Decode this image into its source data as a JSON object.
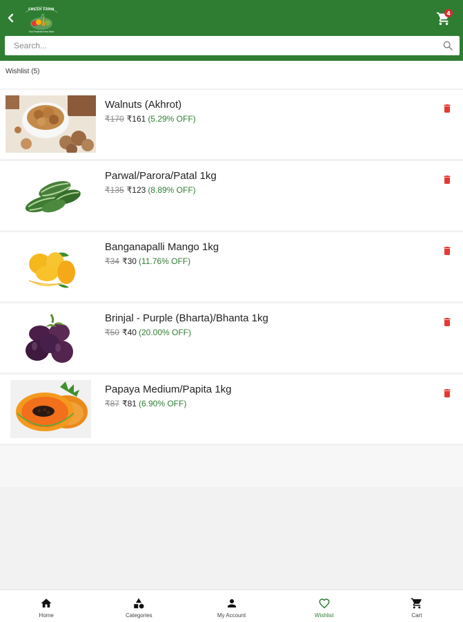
{
  "header": {
    "logo_brand": "FRESH FARM",
    "logo_tagline": "Your Freshest Farm Store",
    "cart_count": "4"
  },
  "search": {
    "placeholder": "Search..."
  },
  "wishlist": {
    "title": "Wishlist (5)"
  },
  "items": [
    {
      "name": "Walnuts (Akhrot)",
      "old_price": "₹170",
      "new_price": "₹161",
      "discount": "(5.29% OFF)",
      "image": "walnuts-image"
    },
    {
      "name": "Parwal/Parora/Patal 1kg",
      "old_price": "₹135",
      "new_price": "₹123",
      "discount": "(8.89% OFF)",
      "image": "parwal-image"
    },
    {
      "name": "Banganapalli Mango 1kg",
      "old_price": "₹34",
      "new_price": "₹30",
      "discount": "(11.76% OFF)",
      "image": "mango-image"
    },
    {
      "name": "Brinjal - Purple (Bharta)/Bhanta 1kg",
      "old_price": "₹50",
      "new_price": "₹40",
      "discount": "(20.00% OFF)",
      "image": "brinjal-image"
    },
    {
      "name": "Papaya Medium/Papita 1kg",
      "old_price": "₹87",
      "new_price": "₹81",
      "discount": "(6.90% OFF)",
      "image": "papaya-image"
    }
  ],
  "bottom_nav": [
    {
      "label": "Home",
      "icon": "home-icon"
    },
    {
      "label": "Categories",
      "icon": "categories-icon"
    },
    {
      "label": "My Account",
      "icon": "account-icon"
    },
    {
      "label": "Wishlist",
      "icon": "heart-icon",
      "active": true
    },
    {
      "label": "Cart",
      "icon": "cart-icon"
    }
  ],
  "colors": {
    "primary": "#2e7d32",
    "delete": "#e53935",
    "badge": "#d32f2f"
  }
}
